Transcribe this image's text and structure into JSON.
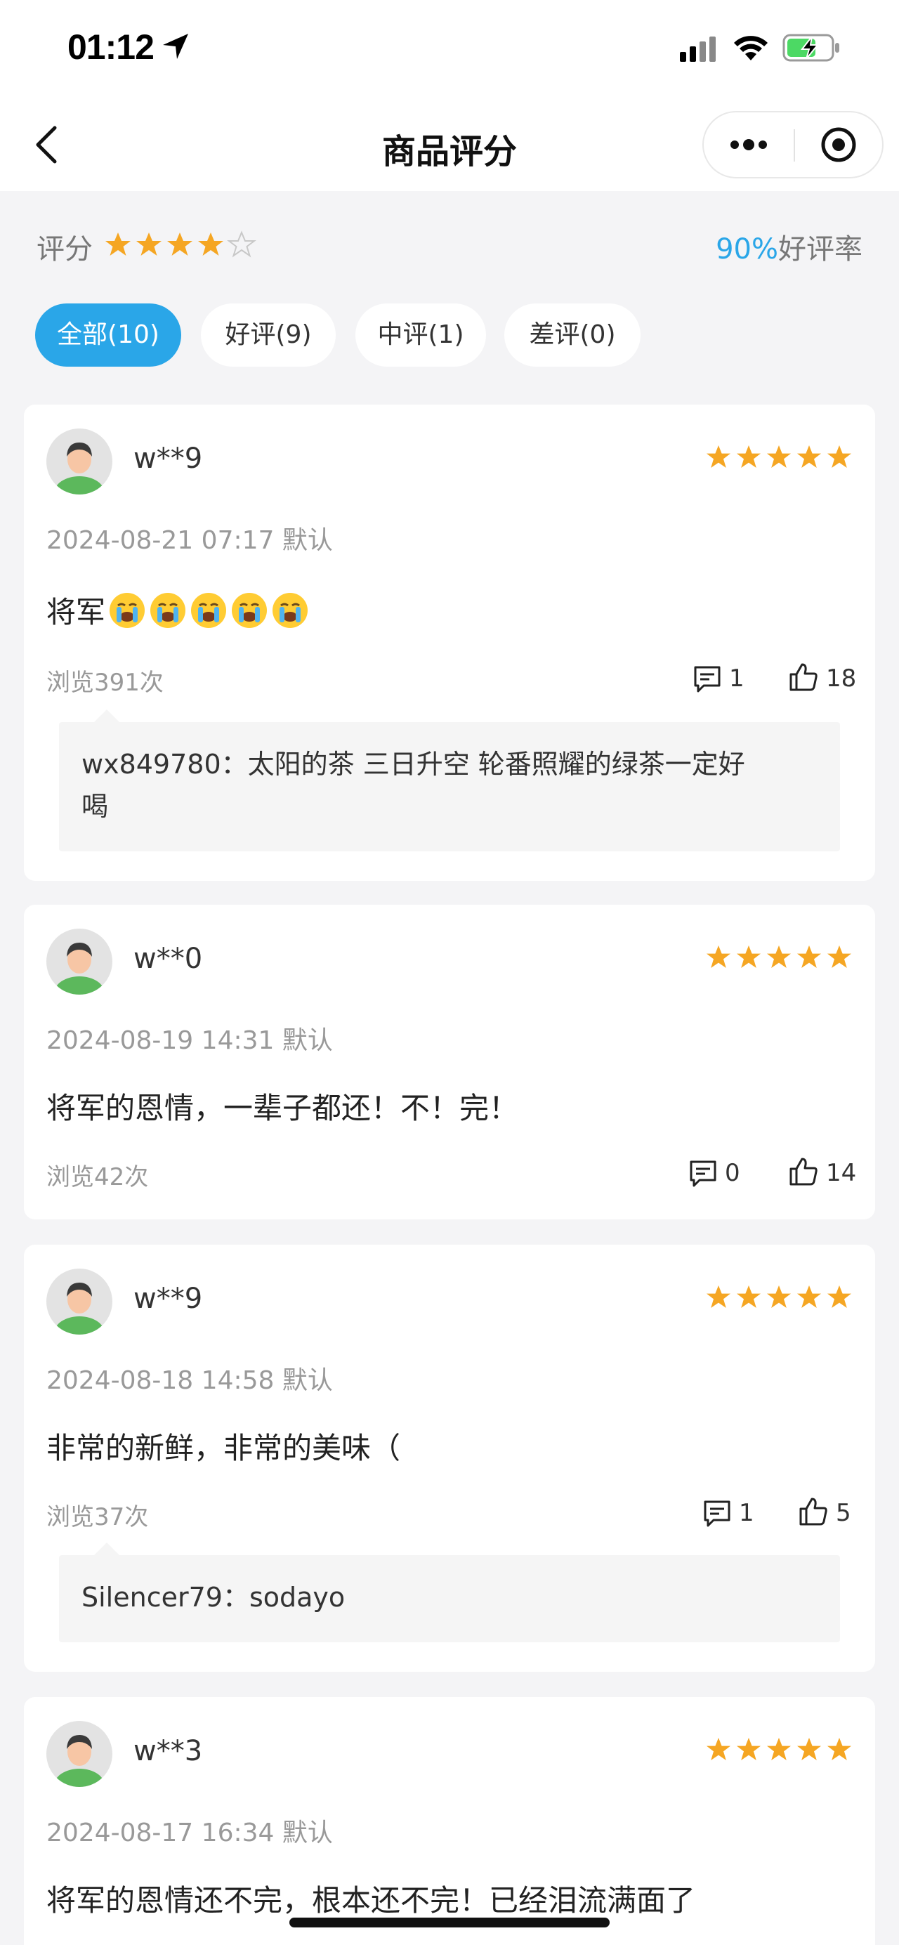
{
  "status_bar": {
    "time": "01:12"
  },
  "nav": {
    "title": "商品评分"
  },
  "summary": {
    "label": "评分",
    "stars_filled": 4,
    "stars_total": 5,
    "rate_percent": "90%",
    "rate_label": "好评率"
  },
  "tabs": [
    {
      "label": "全部(10)",
      "active": true
    },
    {
      "label": "好评(9)",
      "active": false
    },
    {
      "label": "中评(1)",
      "active": false
    },
    {
      "label": "差评(0)",
      "active": false
    }
  ],
  "reviews": [
    {
      "user": "w**9",
      "stars": 5,
      "date": "2024-08-21 07:17 默认",
      "content": "将军",
      "content_emoji": "crying-face-emoji",
      "content_emoji_count": 5,
      "views": "浏览391次",
      "comments": "1",
      "likes": "18",
      "reply_line1": "wx849780：太阳的茶 三日升空 轮番照耀的绿茶一定好",
      "reply_line2": "喝"
    },
    {
      "user": "w**0",
      "stars": 5,
      "date": "2024-08-19 14:31 默认",
      "content": "将军的恩情，一辈子都还！不！完！",
      "views": "浏览42次",
      "comments": "0",
      "likes": "14"
    },
    {
      "user": "w**9",
      "stars": 5,
      "date": "2024-08-18 14:58 默认",
      "content": "非常的新鲜，非常的美味（",
      "views": "浏览37次",
      "comments": "1",
      "likes": "5",
      "reply_line1": "Silencer79：sodayo"
    },
    {
      "user": "w**3",
      "stars": 5,
      "date": "2024-08-17 16:34 默认",
      "content": "将军的恩情还不完，根本还不完！已经泪流满面了"
    }
  ],
  "colors": {
    "accent": "#2aa6e8",
    "star": "#f5a623",
    "background": "#f4f4f6"
  }
}
